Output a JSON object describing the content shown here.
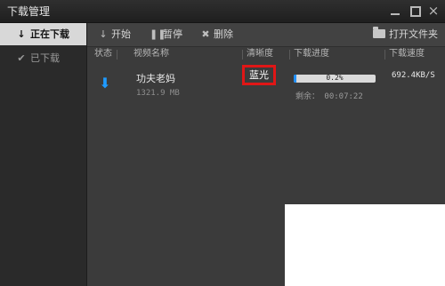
{
  "window": {
    "title": "下载管理",
    "controls": {
      "minimize": "minimize-icon",
      "maximize": "maximize-icon",
      "close": "×"
    }
  },
  "sidebar": {
    "items": [
      {
        "icon": "↓",
        "label": "正在下载",
        "active": true
      },
      {
        "icon": "✔",
        "label": "已下载",
        "active": false
      }
    ]
  },
  "toolbar": {
    "start": {
      "icon": "↓",
      "label": "开始"
    },
    "pause": {
      "icon": "❚❚",
      "label": "暂停"
    },
    "delete": {
      "icon": "✖",
      "label": "删除"
    },
    "open_folder": {
      "icon": "folder-icon",
      "label": "打开文件夹"
    }
  },
  "table": {
    "headers": [
      "状态",
      "视频名称",
      "清晰度",
      "下载进度",
      "下载速度"
    ],
    "rows": [
      {
        "status_icon": "⬇",
        "name": "功夫老妈",
        "size": "1321.9 MB",
        "quality": "蓝光",
        "progress": 0.002,
        "progress_text": "0.2%",
        "remaining": "剩余： 00:07:22",
        "speed": "692.4KB/S"
      }
    ]
  },
  "colors": {
    "accent": "#1e8fff",
    "highlight": "#e01616"
  }
}
